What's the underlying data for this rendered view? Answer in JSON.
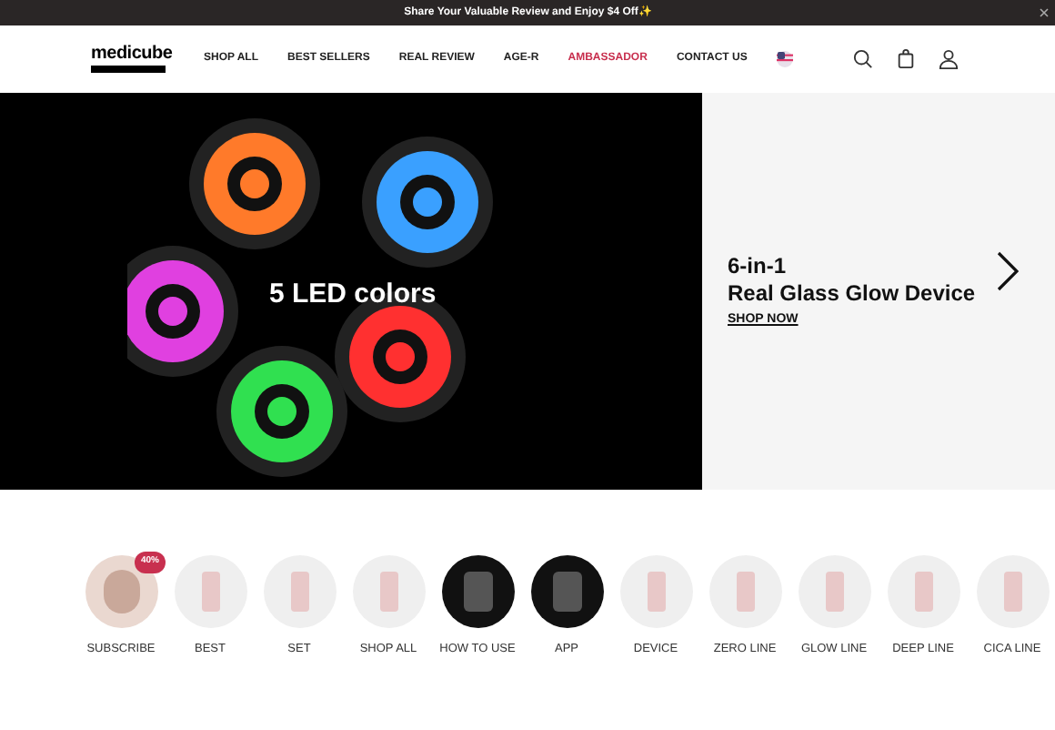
{
  "announcement": {
    "text": "Share Your Valuable Review and Enjoy $4 Off✨"
  },
  "header": {
    "logo": "medicube",
    "nav": [
      {
        "label": "SHOP ALL",
        "highlighted": false
      },
      {
        "label": "BEST SELLERS",
        "highlighted": false
      },
      {
        "label": "REAL REVIEW",
        "highlighted": false
      },
      {
        "label": "AGE-R",
        "highlighted": false
      },
      {
        "label": "AMBASSADOR",
        "highlighted": true
      },
      {
        "label": "CONTACT US",
        "highlighted": false
      }
    ]
  },
  "hero": {
    "image_caption": "5 LED colors",
    "eyebrow": "6-in-1",
    "title": "Real Glass Glow Device",
    "link": "SHOP NOW"
  },
  "categories": [
    {
      "label": "SUBSCRIBE",
      "badge": "40%",
      "kind": "photo"
    },
    {
      "label": "BEST",
      "kind": "product"
    },
    {
      "label": "SET",
      "kind": "product"
    },
    {
      "label": "SHOP ALL",
      "kind": "product"
    },
    {
      "label": "HOW TO USE",
      "kind": "dark"
    },
    {
      "label": "APP",
      "kind": "dark"
    },
    {
      "label": "DEVICE",
      "kind": "product"
    },
    {
      "label": "ZERO LINE",
      "kind": "product"
    },
    {
      "label": "GLOW LINE",
      "kind": "product"
    },
    {
      "label": "DEEP LINE",
      "kind": "product"
    },
    {
      "label": "CICA LINE",
      "kind": "product"
    }
  ]
}
